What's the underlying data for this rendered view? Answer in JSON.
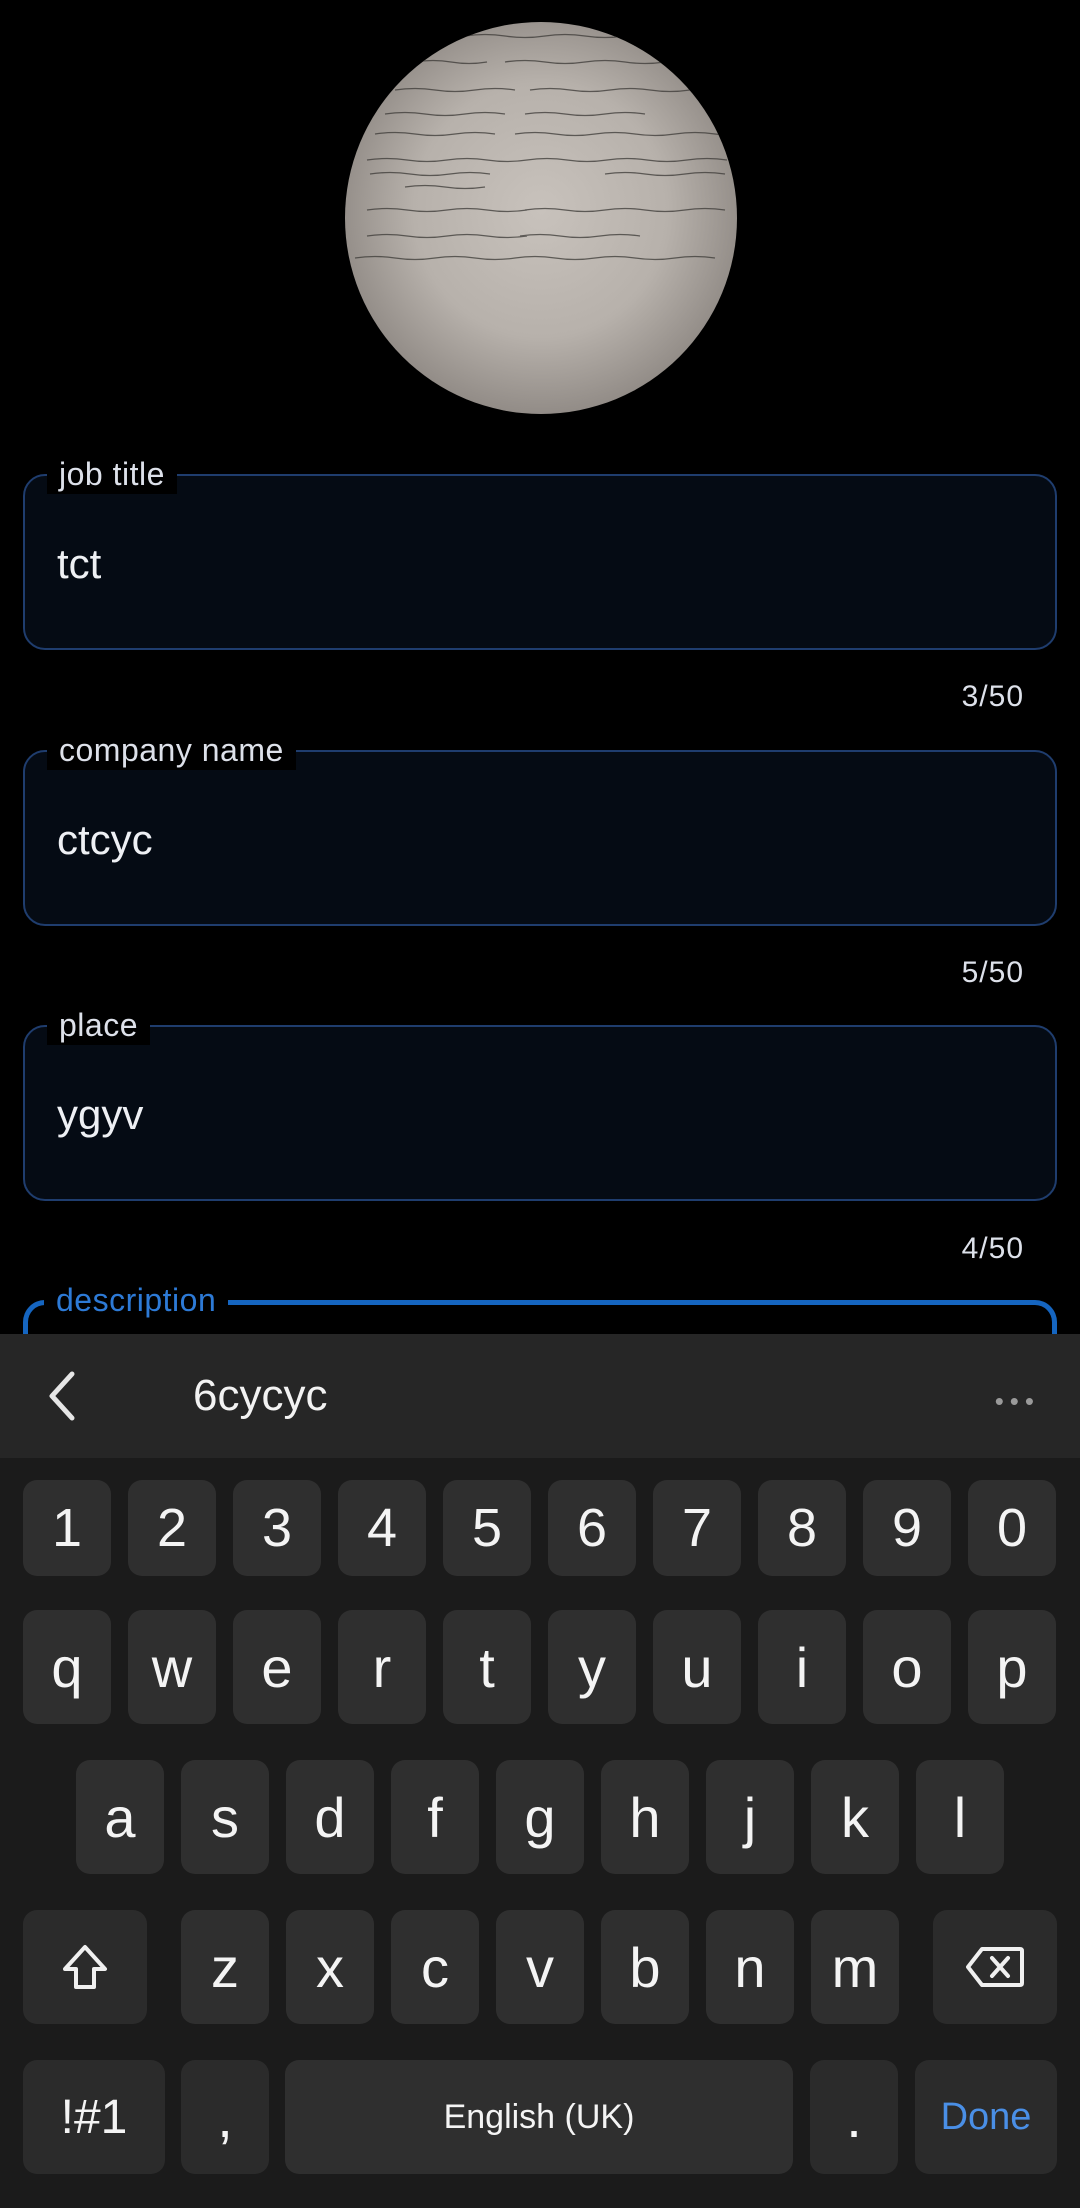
{
  "form": {
    "job_title": {
      "label": "job title",
      "value": "tct",
      "counter": "3/50"
    },
    "company_name": {
      "label": "company name",
      "value": "ctcyc",
      "counter": "5/50"
    },
    "place": {
      "label": "place",
      "value": "ygyv",
      "counter": "4/50"
    },
    "description": {
      "label": "description"
    }
  },
  "keyboard": {
    "suggestion": "6cycyc",
    "more": "•••",
    "number_row": [
      "1",
      "2",
      "3",
      "4",
      "5",
      "6",
      "7",
      "8",
      "9",
      "0"
    ],
    "row1": [
      "q",
      "w",
      "e",
      "r",
      "t",
      "y",
      "u",
      "i",
      "o",
      "p"
    ],
    "row2": [
      "a",
      "s",
      "d",
      "f",
      "g",
      "h",
      "j",
      "k",
      "l"
    ],
    "row3": [
      "z",
      "x",
      "c",
      "v",
      "b",
      "n",
      "m"
    ],
    "symbols_label": "!#1",
    "comma": ",",
    "space_label": "English (UK)",
    "period": ".",
    "done_label": "Done",
    "accent_color": "#4a8fe6"
  }
}
